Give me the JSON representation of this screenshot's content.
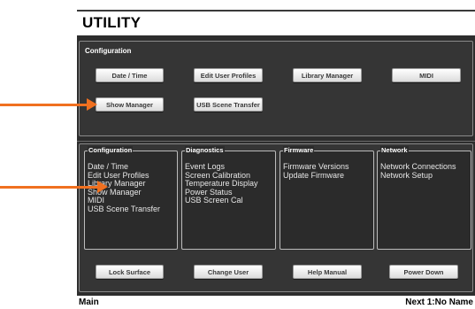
{
  "title": "UTILITY",
  "config_section": {
    "label": "Configuration",
    "buttons": [
      "Date / Time",
      "Edit User Profiles",
      "Library Manager",
      "MIDI",
      "Show Manager",
      "USB Scene Transfer"
    ]
  },
  "groups": [
    {
      "title": "Configuration",
      "items": [
        "Date / Time",
        "Edit User Profiles",
        "Library Manager",
        "Show Manager",
        "MIDI",
        "USB Scene Transfer"
      ]
    },
    {
      "title": "Diagnostics",
      "items": [
        "Event Logs",
        "Screen Calibration",
        "Temperature Display",
        "Power Status",
        "USB Screen Cal"
      ]
    },
    {
      "title": "Firmware",
      "items": [
        "Firmware Versions",
        "Update Firmware"
      ]
    },
    {
      "title": "Network",
      "items": [
        "Network Connections",
        "Network Setup"
      ]
    }
  ],
  "bottom_buttons": [
    "Lock Surface",
    "Change User",
    "Help Manual",
    "Power Down"
  ],
  "footer": {
    "left": "Main",
    "right": "Next 1:No Name"
  },
  "colors": {
    "accent_arrow": "#f07020",
    "background": "#2d2d2d"
  }
}
